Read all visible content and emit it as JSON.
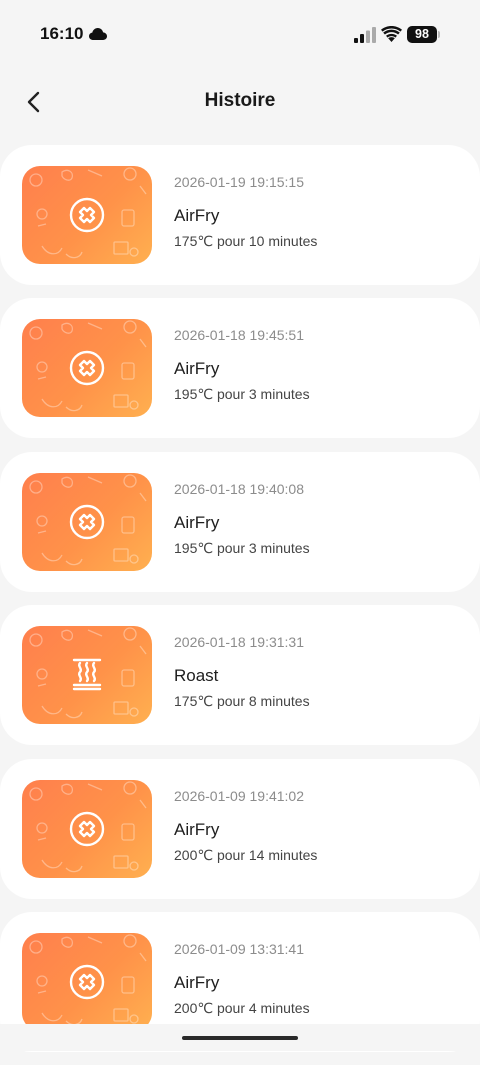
{
  "status_bar": {
    "time": "16:10",
    "battery": "98"
  },
  "header": {
    "title": "Histoire"
  },
  "history": [
    {
      "date": "2026-01-19 19:15:15",
      "mode": "AirFry",
      "detail": "175℃ pour 10 minutes",
      "icon": "airfry-icon"
    },
    {
      "date": "2026-01-18 19:45:51",
      "mode": "AirFry",
      "detail": "195℃ pour 3 minutes",
      "icon": "airfry-icon"
    },
    {
      "date": "2026-01-18 19:40:08",
      "mode": "AirFry",
      "detail": "195℃ pour 3 minutes",
      "icon": "airfry-icon"
    },
    {
      "date": "2026-01-18 19:31:31",
      "mode": "Roast",
      "detail": "175℃ pour 8 minutes",
      "icon": "roast-icon"
    },
    {
      "date": "2026-01-09 19:41:02",
      "mode": "AirFry",
      "detail": "200℃ pour 14 minutes",
      "icon": "airfry-icon"
    },
    {
      "date": "2026-01-09 13:31:41",
      "mode": "AirFry",
      "detail": "200℃ pour 4 minutes",
      "icon": "airfry-icon"
    }
  ],
  "colors": {
    "thumb_gradient_start": "#ff7f4d",
    "thumb_gradient_end": "#ffb050",
    "background": "#f5f5f5",
    "card": "#ffffff"
  }
}
